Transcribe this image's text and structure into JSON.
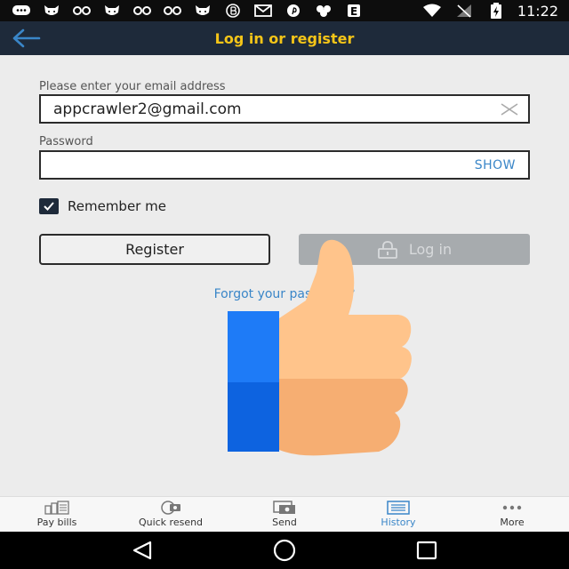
{
  "status_bar": {
    "time": "11:22",
    "left_icons": [
      "message-icon",
      "cat-icon",
      "infinity-icon",
      "cat-icon",
      "infinity-icon",
      "infinity-icon",
      "cat-icon",
      "bitcoin-icon",
      "gmail-icon",
      "pinterest-icon",
      "cluster-icon",
      "e-icon"
    ],
    "right_icons": [
      "wifi-icon",
      "no-signal-icon",
      "battery-charging-icon"
    ]
  },
  "app_bar": {
    "title": "Log in or register",
    "title_color": "#f5c518",
    "background": "#1e2a3a"
  },
  "form": {
    "email_label": "Please enter your email address",
    "email_value": "appcrawler2@gmail.com",
    "password_label": "Password",
    "password_value": "",
    "show_label": "SHOW",
    "remember_label": "Remember me",
    "remember_checked": true,
    "register_label": "Register",
    "login_label": "Log in",
    "forgot_label": "Forgot your password?",
    "link_color": "#3a86c8"
  },
  "bottom_nav": {
    "items": [
      {
        "label": "Pay bills",
        "icon": "pay-bills-icon"
      },
      {
        "label": "Quick resend",
        "icon": "quick-resend-icon"
      },
      {
        "label": "Send",
        "icon": "send-icon"
      },
      {
        "label": "History",
        "icon": "history-icon",
        "active": true
      },
      {
        "label": "More",
        "icon": "more-icon"
      }
    ]
  },
  "system_nav": {
    "icons": [
      "back-triangle-icon",
      "home-circle-icon",
      "recents-square-icon"
    ]
  }
}
